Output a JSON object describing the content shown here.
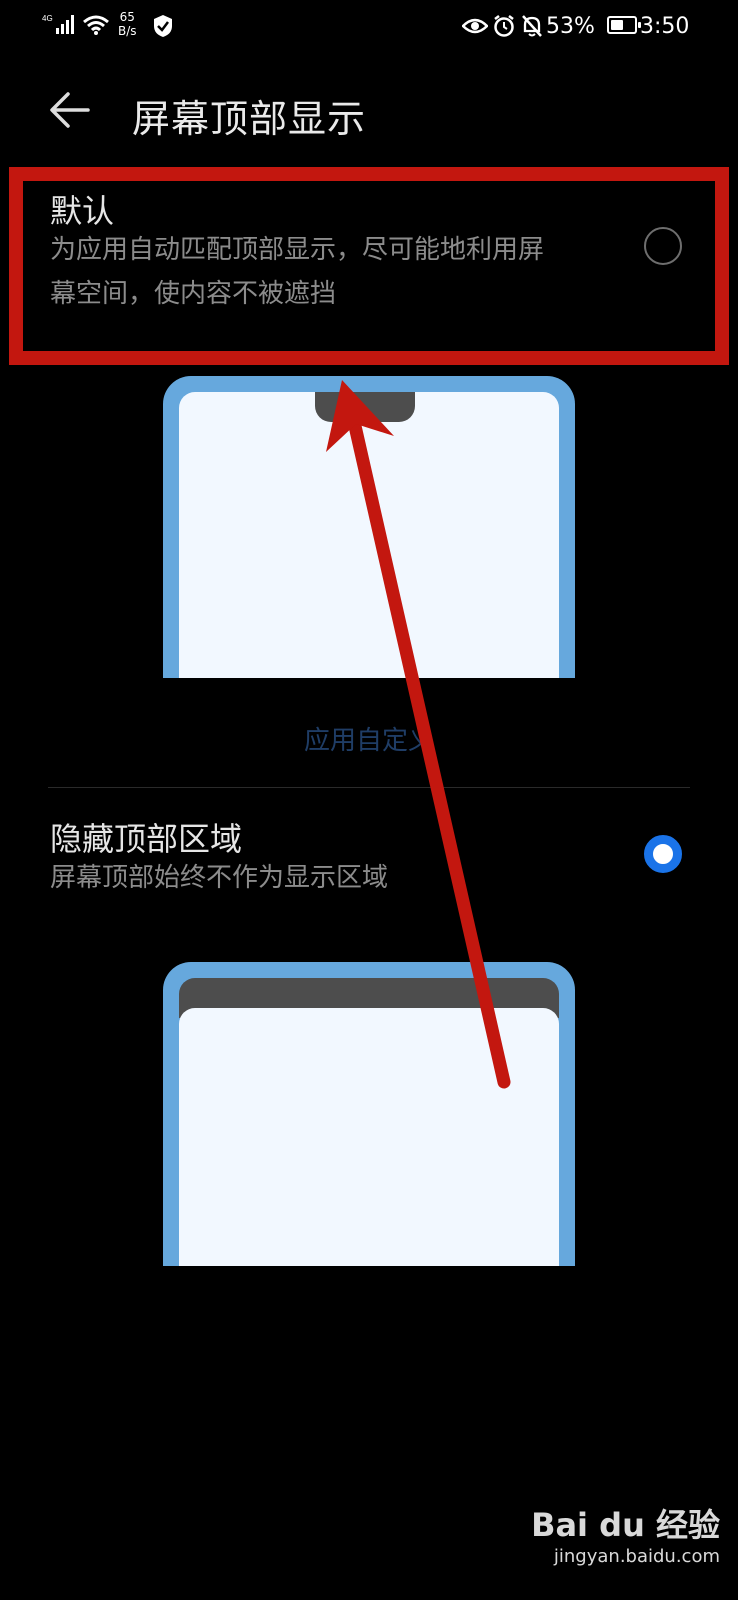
{
  "status_bar": {
    "signal": "4G",
    "net_speed_value": "65",
    "net_speed_unit": "B/s",
    "battery": "53%",
    "battery_level": 0.53,
    "time": "3:50",
    "icons": [
      "signal-icon",
      "wifi-icon",
      "shield-icon",
      "eye-icon",
      "alarm-icon",
      "bell-off-icon",
      "battery-icon"
    ]
  },
  "header": {
    "title": "屏幕顶部显示",
    "back_icon": "back-arrow-icon"
  },
  "options": [
    {
      "title": "默认",
      "desc_line1": "为应用自动匹配顶部显示，尽可能地利用屏",
      "desc_line2": "幕空间，使内容不被遮挡",
      "selected": false
    },
    {
      "title": "隐藏顶部区域",
      "desc": "屏幕顶部始终不作为显示区域",
      "selected": true
    }
  ],
  "custom_link": "应用自定义",
  "annotation": {
    "color": "#c3170f"
  },
  "watermark": {
    "brand": "Bai du 经验",
    "url": "jingyan.baidu.com"
  },
  "colors": {
    "accent": "#1a73e8",
    "phone_frame": "#66a8dd",
    "phone_screen": "#f2f8ff"
  }
}
